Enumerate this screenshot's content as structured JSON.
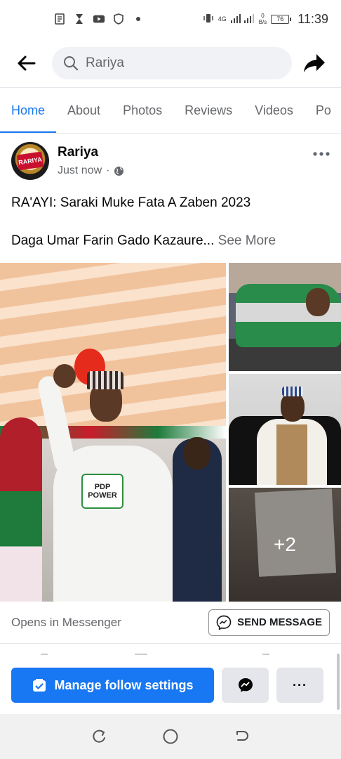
{
  "status_bar": {
    "time": "11:39",
    "battery": "76",
    "network": "4G",
    "speed_value": "0",
    "speed_unit": "B/s",
    "icons_left": [
      "notes-icon",
      "hourglass-icon",
      "youtube-icon",
      "shield-icon",
      "dot-icon"
    ]
  },
  "search": {
    "query": "Rariya"
  },
  "tabs": [
    {
      "label": "Home",
      "active": true
    },
    {
      "label": "About",
      "active": false
    },
    {
      "label": "Photos",
      "active": false
    },
    {
      "label": "Reviews",
      "active": false
    },
    {
      "label": "Videos",
      "active": false
    },
    {
      "label": "Po",
      "active": false
    }
  ],
  "post": {
    "page_name": "Rariya",
    "time": "Just now",
    "separator": "·",
    "avatar_text": "RARIYA",
    "headline": "RA'AYI: Saraki Muke Fata A Zaben 2023",
    "byline": "Daga Umar Farin Gado Kazaure...",
    "see_more": "See More",
    "more_photos": "+2",
    "banner_text_1": "PDP",
    "banner_text_2": "POWER"
  },
  "messenger": {
    "label": "Opens in Messenger",
    "button": "SEND MESSAGE"
  },
  "actions": {
    "manage": "Manage follow settings",
    "more": "···"
  },
  "colors": {
    "accent": "#1877f2",
    "secondary_text": "#65676b",
    "button_grey": "#e4e6eb"
  }
}
